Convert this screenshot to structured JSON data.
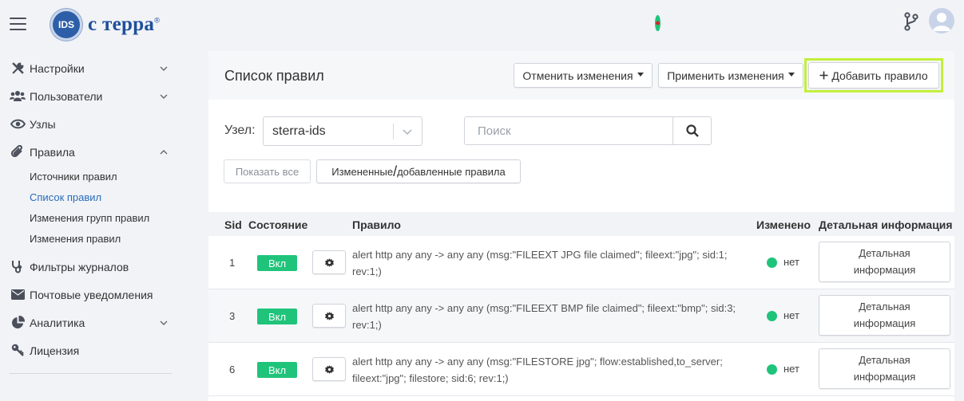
{
  "brand": {
    "logo_badge": "IDS",
    "name_c": "с",
    "name_rest": "терра",
    "reg": "®"
  },
  "sidebar": {
    "items": [
      {
        "label": "Настройки",
        "icon": "wrench-icon"
      },
      {
        "label": "Пользователи",
        "icon": "users-icon"
      },
      {
        "label": "Узлы",
        "icon": "eye-icon"
      },
      {
        "label": "Правила",
        "icon": "paperclip-icon"
      },
      {
        "label": "Фильтры журналов",
        "icon": "stethoscope-icon"
      },
      {
        "label": "Почтовые уведомления",
        "icon": "envelope-icon"
      },
      {
        "label": "Аналитика",
        "icon": "pie-chart-icon"
      },
      {
        "label": "Лицензия",
        "icon": "key-icon"
      }
    ],
    "sub_items": [
      {
        "label": "Источники правил",
        "active": false
      },
      {
        "label": "Список правил",
        "active": true
      },
      {
        "label": "Изменения групп правил",
        "active": false
      },
      {
        "label": "Изменения правил",
        "active": false
      }
    ]
  },
  "panel": {
    "title": "Список правил",
    "cancel_label": "Отменить изменения",
    "apply_label": "Применить изменения",
    "add_label": "Добавить правило",
    "node_label": "Узел:",
    "node_value": "sterra-ids",
    "search_placeholder": "Поиск",
    "show_all_label": "Показать все",
    "changed_label_a": "Измененные",
    "changed_label_b": "добавленные правила"
  },
  "table": {
    "headers": {
      "sid": "Sid",
      "state": "Состояние",
      "rule": "Правило",
      "changed": "Изменено",
      "detail": "Детальная информация"
    },
    "rows": [
      {
        "sid": "1",
        "state": "Вкл",
        "rule": "alert http any any -> any any (msg:\"FILEEXT JPG file claimed\"; fileext:\"jpg\"; sid:1; rev:1;)",
        "changed": "нет",
        "detail": "Детальная информация"
      },
      {
        "sid": "3",
        "state": "Вкл",
        "rule": "alert http any any -> any any (msg:\"FILEEXT BMP file claimed\"; fileext:\"bmp\"; sid:3; rev:1;)",
        "changed": "нет",
        "detail": "Детальная информация"
      },
      {
        "sid": "6",
        "state": "Вкл",
        "rule": "alert http any any -> any any (msg:\"FILESTORE jpg\"; flow:established,to_server; fileext:\"jpg\"; filestore; sid:6; rev:1;)",
        "changed": "нет",
        "detail": "Детальная информация"
      }
    ]
  },
  "colors": {
    "accent": "#2a6cb8",
    "status_on": "#1fc47a",
    "highlight": "#c3f03a"
  }
}
